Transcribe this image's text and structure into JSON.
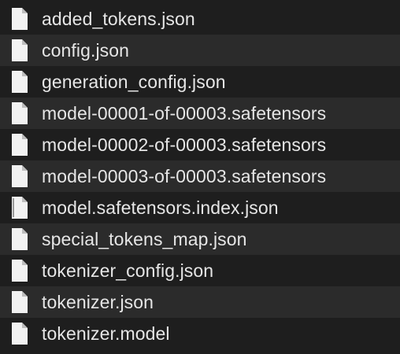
{
  "files": [
    {
      "name": "added_tokens.json",
      "icon": "document-icon"
    },
    {
      "name": "config.json",
      "icon": "document-icon"
    },
    {
      "name": "generation_config.json",
      "icon": "document-icon"
    },
    {
      "name": "model-00001-of-00003.safetensors",
      "icon": "document-icon"
    },
    {
      "name": "model-00002-of-00003.safetensors",
      "icon": "document-icon"
    },
    {
      "name": "model-00003-of-00003.safetensors",
      "icon": "document-icon"
    },
    {
      "name": "model.safetensors.index.json",
      "icon": "document-icon"
    },
    {
      "name": "special_tokens_map.json",
      "icon": "document-icon"
    },
    {
      "name": "tokenizer_config.json",
      "icon": "document-icon"
    },
    {
      "name": "tokenizer.json",
      "icon": "document-icon"
    },
    {
      "name": "tokenizer.model",
      "icon": "document-icon"
    }
  ],
  "colors": {
    "background": "#1e1e1e",
    "row_alt": "#2b2b2b",
    "text": "#e6e6e6",
    "icon_fill": "#f2f2f2",
    "icon_fold": "#bdbdbd"
  }
}
